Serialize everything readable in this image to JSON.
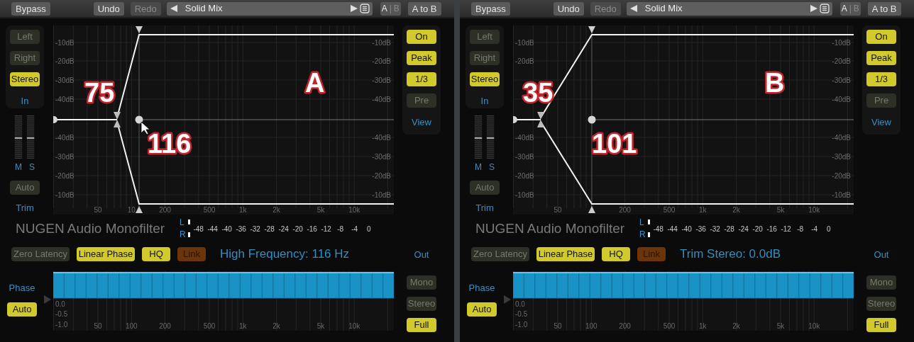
{
  "panels": [
    {
      "toolbar": {
        "bypass": "Bypass",
        "undo": {
          "label": "Undo",
          "disabled": false
        },
        "redo": {
          "label": "Redo",
          "disabled": true
        },
        "preset": "Solid Mix",
        "ab": [
          {
            "label": "A",
            "selected": true
          },
          {
            "label": "|",
            "selected": false
          },
          {
            "label": "B",
            "selected": false
          }
        ],
        "copy": "A to B"
      },
      "channel_buttons": [
        {
          "label": "Left",
          "on": false
        },
        {
          "label": "Right",
          "on": false
        },
        {
          "label": "Stereo",
          "on": true
        }
      ],
      "in_label": "In",
      "meter_labels": [
        "M",
        "S"
      ],
      "auto_button": {
        "label": "Auto",
        "on": false
      },
      "trim_label": "Trim",
      "graph": {
        "db_labels_left": [
          "-10dB",
          "-20dB",
          "-30dB",
          "-40dB",
          "-40dB",
          "-30dB",
          "-20dB",
          "-10dB"
        ],
        "db_labels_right": [
          "-10dB",
          "-20dB",
          "-30dB",
          "-40dB",
          "-40dB",
          "-30dB",
          "-20dB",
          "-10dB"
        ],
        "freq_labels": [
          "50",
          "10",
          "200",
          "500",
          "1k",
          "2k",
          "5k",
          "10k"
        ],
        "low_value": "75",
        "high_value": "116",
        "letter": "A"
      },
      "view_buttons": [
        {
          "label": "On",
          "on": true
        },
        {
          "label": "Peak",
          "on": true
        },
        {
          "label": "1/3",
          "on": true
        },
        {
          "label": "Pre",
          "on": false
        }
      ],
      "view_label": "View",
      "title": "NUGEN Audio Monofilter",
      "level_meter": {
        "channels": [
          "L",
          "R"
        ],
        "scale": [
          "-48",
          "-44",
          "-40",
          "-36",
          "-32",
          "-28",
          "-24",
          "-20",
          "-16",
          "-12",
          "-8",
          "-4",
          "0"
        ]
      },
      "options": [
        {
          "label": "Zero Latency",
          "kind": "toggle",
          "on": false
        },
        {
          "label": "Linear Phase",
          "kind": "toggle",
          "on": true
        },
        {
          "label": "HQ",
          "kind": "toggle",
          "on": true
        },
        {
          "label": "Link",
          "kind": "link",
          "on": false
        }
      ],
      "status": "High Frequency: 116 Hz",
      "out_label": "Out",
      "out_buttons": [
        {
          "label": "Mono",
          "selected": false
        },
        {
          "label": "Stereo",
          "selected": false
        },
        {
          "label": "Full",
          "selected": true
        }
      ],
      "phase": {
        "label": "Phase",
        "auto_button": {
          "label": "Auto",
          "on": true
        },
        "y_labels": [
          "0.0",
          "-0.5",
          "-1.0"
        ],
        "freq_labels": [
          "50",
          "100",
          "200",
          "500",
          "1k",
          "2k",
          "5k",
          "10k"
        ]
      }
    },
    {
      "toolbar": {
        "bypass": "Bypass",
        "undo": {
          "label": "Undo",
          "disabled": false
        },
        "redo": {
          "label": "Redo",
          "disabled": true
        },
        "preset": "Solid Mix",
        "ab": [
          {
            "label": "A",
            "selected": true
          },
          {
            "label": "|",
            "selected": false
          },
          {
            "label": "B",
            "selected": false
          }
        ],
        "copy": "A to B"
      },
      "channel_buttons": [
        {
          "label": "Left",
          "on": false
        },
        {
          "label": "Right",
          "on": false
        },
        {
          "label": "Stereo",
          "on": true
        }
      ],
      "in_label": "In",
      "meter_labels": [
        "M",
        "S"
      ],
      "auto_button": {
        "label": "Auto",
        "on": false
      },
      "trim_label": "Trim",
      "graph": {
        "db_labels_left": [
          "-10dB",
          "-20dB",
          "-40dB",
          "-30dB",
          "-20dB",
          "-10dB"
        ],
        "db_labels_right": [
          "-10dB",
          "-20dB",
          "-30dB",
          "-40dB",
          "-40dB",
          "-30dB",
          "-20dB",
          "-10dB"
        ],
        "freq_labels": [
          "50",
          "200",
          "500",
          "1k",
          "2k",
          "5k",
          "10k"
        ],
        "low_value": "35",
        "high_value": "101",
        "letter": "B"
      },
      "view_buttons": [
        {
          "label": "On",
          "on": true
        },
        {
          "label": "Peak",
          "on": true
        },
        {
          "label": "1/3",
          "on": true
        },
        {
          "label": "Pre",
          "on": false
        }
      ],
      "view_label": "View",
      "title": "NUGEN Audio Monofilter",
      "level_meter": {
        "channels": [
          "L",
          "R"
        ],
        "scale": [
          "-48",
          "-44",
          "-40",
          "-36",
          "-32",
          "-28",
          "-24",
          "-20",
          "-16",
          "-12",
          "-8",
          "-4",
          "0"
        ]
      },
      "options": [
        {
          "label": "Zero Latency",
          "kind": "toggle",
          "on": false
        },
        {
          "label": "Linear Phase",
          "kind": "toggle",
          "on": true
        },
        {
          "label": "HQ",
          "kind": "toggle",
          "on": true
        },
        {
          "label": "Link",
          "kind": "link",
          "on": false
        }
      ],
      "status": "Trim Stereo: 0.0dB",
      "out_label": "Out",
      "out_buttons": [
        {
          "label": "Mono",
          "selected": false
        },
        {
          "label": "Stereo",
          "selected": false
        },
        {
          "label": "Full",
          "selected": true
        }
      ],
      "phase": {
        "label": "Phase",
        "auto_button": {
          "label": "Auto",
          "on": true
        },
        "y_labels": [
          "0.0",
          "-0.5",
          "-1.0"
        ],
        "freq_labels": [
          "50",
          "100",
          "200",
          "500",
          "1k",
          "2k",
          "5k",
          "10k"
        ]
      }
    }
  ]
}
